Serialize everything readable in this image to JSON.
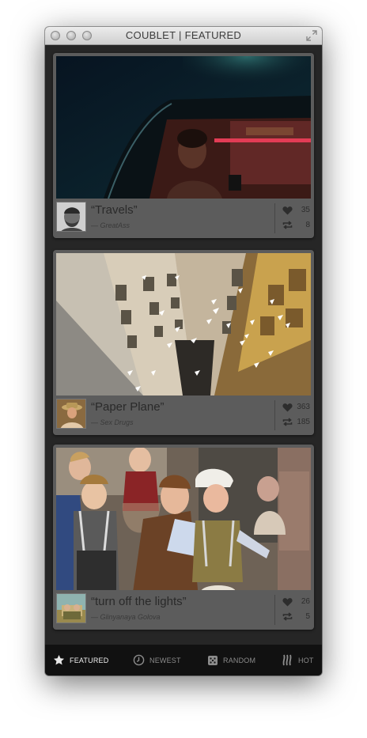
{
  "window": {
    "title": "COUBLET | FEATURED"
  },
  "cards": [
    {
      "title": "“Travels”",
      "author": "— GreatAss",
      "likes": "35",
      "recoubs": "8"
    },
    {
      "title": "“Paper Plane”",
      "author": "— Sex Drugs",
      "likes": "363",
      "recoubs": "185"
    },
    {
      "title": "“turn off the lights”",
      "author": "— Glinyanaya Golova",
      "likes": "26",
      "recoubs": "5"
    }
  ],
  "nav": [
    {
      "label": "FEATURED",
      "icon": "star-icon",
      "active": true
    },
    {
      "label": "NEWEST",
      "icon": "clock-icon",
      "active": false
    },
    {
      "label": "RANDOM",
      "icon": "dice-icon",
      "active": false
    },
    {
      "label": "HOT",
      "icon": "flame-icon",
      "active": false
    }
  ]
}
